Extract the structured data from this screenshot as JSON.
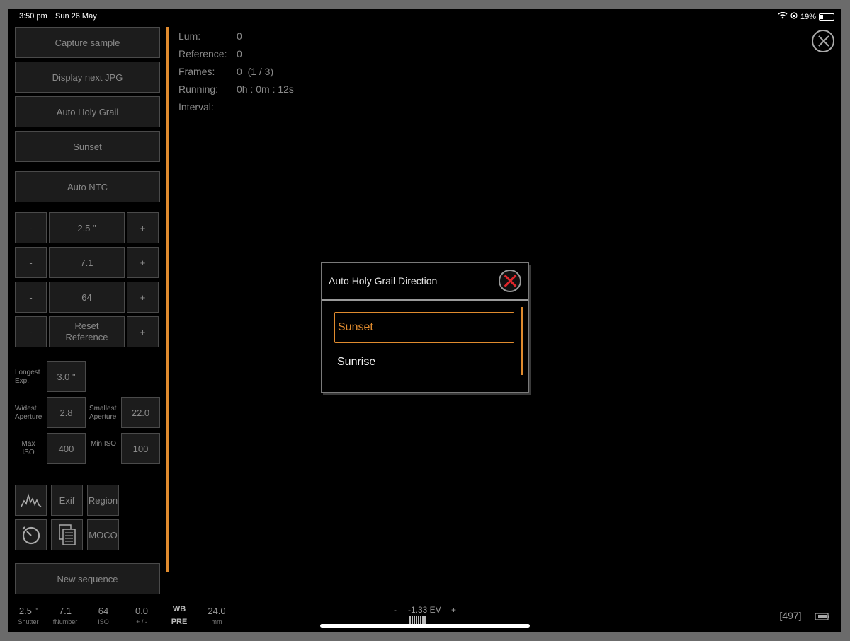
{
  "status": {
    "time": "3:50 pm",
    "date": "Sun 26 May",
    "battery": "19%"
  },
  "sidebar": {
    "buttons": [
      "Capture sample",
      "Display next JPG",
      "Auto Holy Grail",
      "Sunset",
      "Auto NTC"
    ],
    "steppers": [
      {
        "minus": "-",
        "value": "2.5 \"",
        "plus": "+"
      },
      {
        "minus": "-",
        "value": "7.1",
        "plus": "+"
      },
      {
        "minus": "-",
        "value": "64",
        "plus": "+"
      },
      {
        "minus": "-",
        "value": "Reset Reference",
        "plus": "+"
      }
    ],
    "longest_exp": {
      "label": "Longest Exp.",
      "value": "3.0 \""
    },
    "widest_aperture": {
      "label": "Widest Aperture",
      "value": "2.8"
    },
    "smallest_aperture": {
      "label": "Smallest Aperture",
      "value": "22.0"
    },
    "max_iso": {
      "label": "Max ISO",
      "value": "400"
    },
    "min_iso": {
      "label": "Min ISO",
      "value": "100"
    },
    "tools": {
      "exif": "Exif",
      "region": "Region",
      "moco": "MOCO"
    },
    "new_sequence": "New sequence"
  },
  "info": {
    "lum_label": "Lum:",
    "lum_value": "0",
    "reference_label": "Reference:",
    "reference_value": "0",
    "frames_label": "Frames:",
    "frames_value": "0  (1 / 3)",
    "running_label": "Running:",
    "running_value": "0h : 0m : 12s",
    "interval_label": "Interval:"
  },
  "dialog": {
    "title": "Auto Holy Grail Direction",
    "options": [
      "Sunset",
      "Sunrise"
    ],
    "selected_index": 0
  },
  "bottom": {
    "shutter": {
      "value": "2.5 \"",
      "caption": "Shutter"
    },
    "fnumber": {
      "value": "7.1",
      "caption": "fNumber"
    },
    "iso": {
      "value": "64",
      "caption": "ISO"
    },
    "ev_comp": {
      "value": "0.0",
      "caption": "+ / -"
    },
    "wb": {
      "value": "WB",
      "caption": "PRE"
    },
    "focal": {
      "value": "24.0",
      "caption": "mm"
    },
    "ev_minus": "-",
    "ev_value": "-1.33 EV",
    "ev_plus": "+",
    "counter": "[497]"
  },
  "colors": {
    "accent": "#e08b2e",
    "close_red": "#e0262b"
  }
}
